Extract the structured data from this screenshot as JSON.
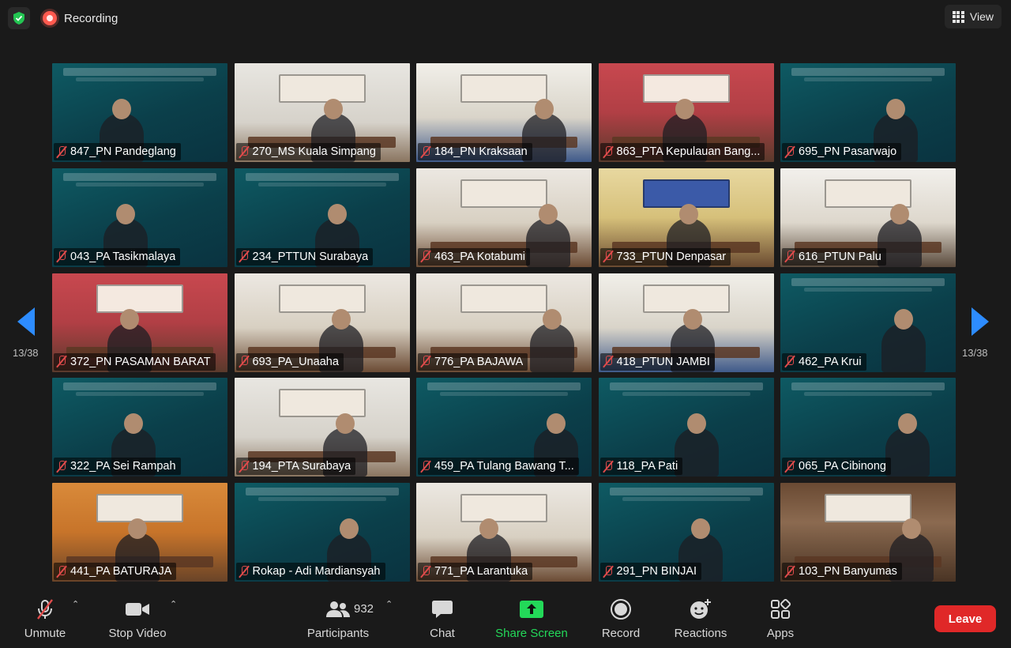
{
  "top_bar": {
    "recording_label": "Recording",
    "view_label": "View"
  },
  "pagination": {
    "left": "13/38",
    "right": "13/38"
  },
  "participants_grid": [
    {
      "name": "847_PN Pandeglang",
      "muted": true,
      "scene": "teal-banner"
    },
    {
      "name": "270_MS Kuala Simpang",
      "muted": true,
      "scene": "wall"
    },
    {
      "name": "184_PN Kraksaan",
      "muted": true,
      "scene": "hall"
    },
    {
      "name": "863_PTA Kepulauan Bang...",
      "muted": true,
      "scene": "red-room"
    },
    {
      "name": "695_PN Pasarwajo",
      "muted": true,
      "scene": "teal-banner"
    },
    {
      "name": "043_PA Tasikmalaya",
      "muted": true,
      "scene": "teal-banner"
    },
    {
      "name": "234_PTTUN Surabaya",
      "muted": true,
      "scene": "teal-banner"
    },
    {
      "name": "463_PA Kotabumi",
      "muted": true,
      "scene": "media-room"
    },
    {
      "name": "733_PTUN Denpasar",
      "muted": true,
      "scene": "yellow-room"
    },
    {
      "name": "616_PTUN Palu",
      "muted": true,
      "scene": "office"
    },
    {
      "name": "372_PN PASAMAN BARAT",
      "muted": true,
      "scene": "red-room"
    },
    {
      "name": "693_PA_Unaaha",
      "muted": true,
      "scene": "media-room"
    },
    {
      "name": "776_PA BAJAWA",
      "muted": true,
      "scene": "media-room"
    },
    {
      "name": "418_PTUN JAMBI",
      "muted": true,
      "scene": "hall"
    },
    {
      "name": "462_PA Krui",
      "muted": true,
      "scene": "teal-banner"
    },
    {
      "name": "322_PA Sei Rampah",
      "muted": true,
      "scene": "teal-banner"
    },
    {
      "name": "194_PTA Surabaya",
      "muted": true,
      "scene": "wall"
    },
    {
      "name": "459_PA Tulang Bawang T...",
      "muted": true,
      "scene": "teal-banner"
    },
    {
      "name": "118_PA Pati",
      "muted": true,
      "scene": "teal-banner"
    },
    {
      "name": "065_PA Cibinong",
      "muted": true,
      "scene": "teal-banner"
    },
    {
      "name": "441_PA BATURAJA",
      "muted": true,
      "scene": "orange-room"
    },
    {
      "name": "Rokap - Adi Mardiansyah",
      "muted": true,
      "scene": "teal-banner"
    },
    {
      "name": "771_PA Larantuka",
      "muted": true,
      "scene": "media-room"
    },
    {
      "name": "291_PN BINJAI",
      "muted": true,
      "scene": "teal-banner"
    },
    {
      "name": "103_PN Banyumas",
      "muted": true,
      "scene": "brown-room"
    }
  ],
  "toolbar": {
    "unmute_label": "Unmute",
    "stop_video_label": "Stop Video",
    "participants_label": "Participants",
    "participants_count": "932",
    "chat_label": "Chat",
    "share_screen_label": "Share Screen",
    "record_label": "Record",
    "reactions_label": "Reactions",
    "apps_label": "Apps",
    "leave_label": "Leave"
  },
  "colors": {
    "background": "#1a1a1a",
    "accent_blue": "#2d8cff",
    "share_green": "#23d959",
    "leave_red": "#e02828",
    "muted_red": "#e04b4b"
  }
}
